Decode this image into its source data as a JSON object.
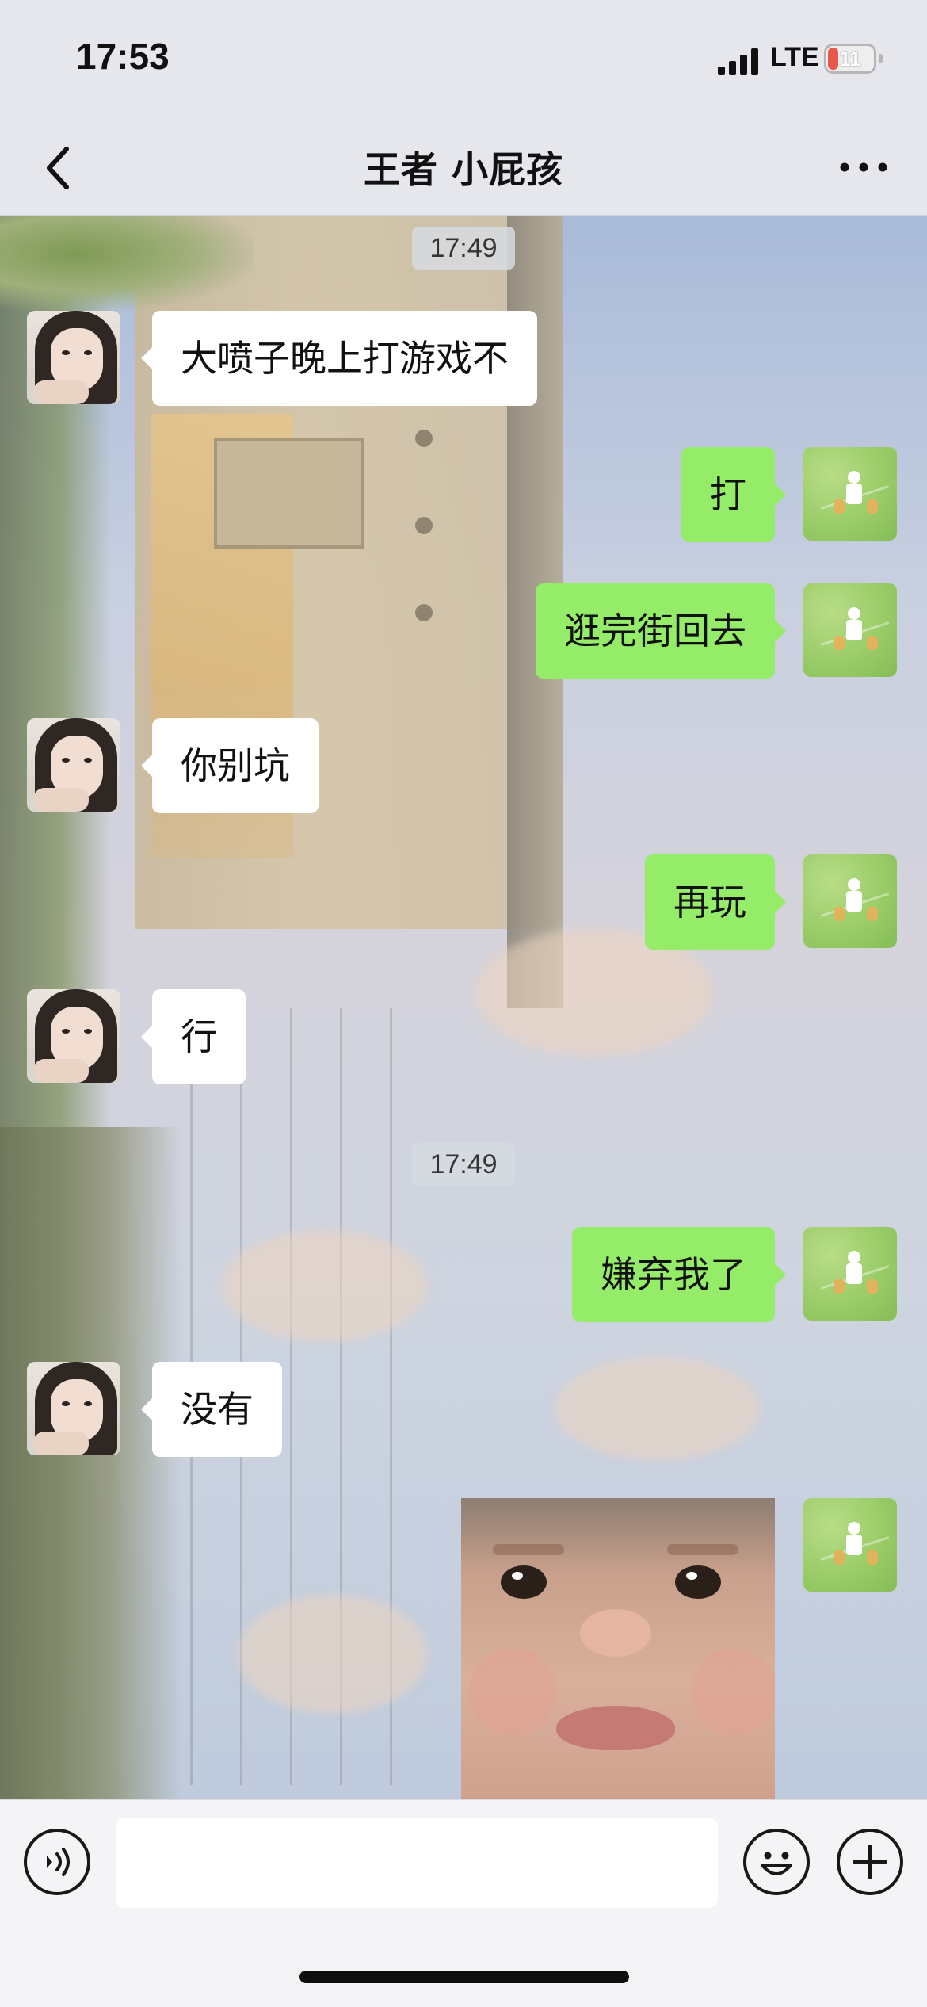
{
  "status_bar": {
    "time": "17:53",
    "network": "LTE",
    "battery": "11",
    "battery_color": "#e8574b"
  },
  "nav": {
    "title": "王者  小屁孩",
    "back_icon": "chevron-left-icon",
    "more_icon": "more-dots-icon"
  },
  "chat": {
    "timestamps": [
      "17:49",
      "17:49"
    ],
    "messages": [
      {
        "side": "in",
        "text": "大喷子晚上打游戏不"
      },
      {
        "side": "out",
        "text": "打"
      },
      {
        "side": "out",
        "text": "逛完街回去"
      },
      {
        "side": "in",
        "text": "你别坑"
      },
      {
        "side": "out",
        "text": "再玩"
      },
      {
        "side": "in",
        "text": "行"
      },
      {
        "side": "out",
        "text": "嫌弃我了"
      },
      {
        "side": "in",
        "text": "没有"
      },
      {
        "side": "out",
        "type": "sticker",
        "sticker": "pouting-baby-sticker"
      }
    ],
    "colors": {
      "outgoing_bubble": "#95ec69",
      "incoming_bubble": "#ffffff"
    }
  },
  "input_bar": {
    "input_value": "",
    "icons": [
      "voice-icon",
      "emoji-icon",
      "plus-icon"
    ]
  }
}
